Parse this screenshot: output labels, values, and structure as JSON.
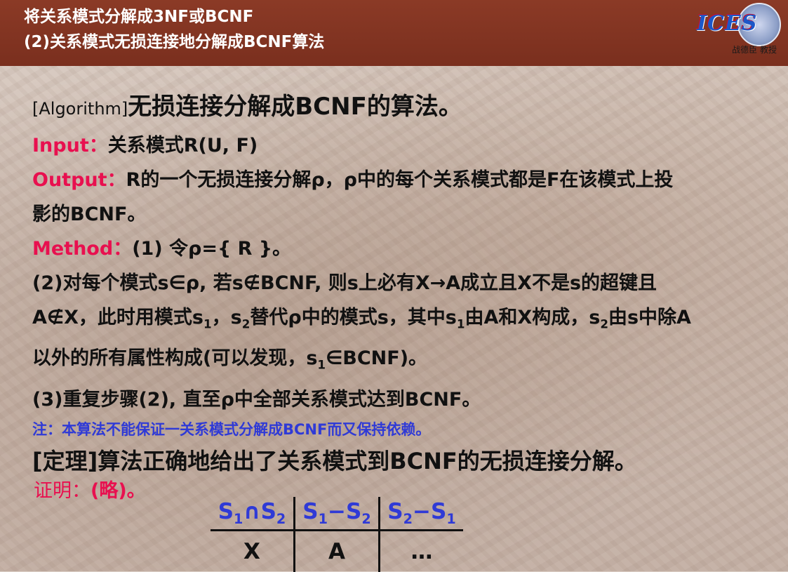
{
  "header": {
    "line1": "将关系模式分解成3NF或BCNF",
    "line2": "(2)关系模式无损连接地分解成BCNF算法"
  },
  "logo": {
    "brand": "ICES",
    "author": "战德臣 教授"
  },
  "algorithm": {
    "title_bracket": "[Algorithm]",
    "title_main": "无损连接分解成BCNF的算法。",
    "input_label": "Input：",
    "input_text": "关系模式R(U, F)",
    "output_label": "Output：",
    "output_text_1": "R的一个无损连接分解ρ，ρ中的每个关系模式都是F在该模式上投",
    "output_text_2": "影的BCNF。",
    "method_label": "Method：",
    "method_text": "(1) 令ρ={ R }。",
    "step2_line1": "(2)对每个模式s∈ρ, 若s∉BCNF, 则s上必有X→A成立且X不是s的超键且",
    "step2_l2_a": "A∉X，此时用模式s",
    "step2_l2_b": "1",
    "step2_l2_c": "，s",
    "step2_l2_d": "2",
    "step2_l2_e": "替代ρ中的模式s，其中s",
    "step2_l2_f": "1",
    "step2_l2_g": "由A和X构成，s",
    "step2_l2_h": "2",
    "step2_l2_i": "由s中除A",
    "step2_l3_a": "以外的所有属性构成(可以发现，s",
    "step2_l3_b": "1",
    "step2_l3_c": "∈BCNF)。",
    "step3": "(3)重复步骤(2), 直至ρ中全部关系模式达到BCNF。",
    "note": "注：本算法不能保证一关系模式分解成BCNF而又保持依赖。"
  },
  "theorem": "[定理]算法正确地给出了关系模式到BCNF的无损连接分解。",
  "proof": {
    "label": "证明：",
    "text": "(略)。"
  },
  "table": {
    "headers": [
      {
        "a": "S",
        "a_sub": "1",
        "op": "∩",
        "b": "S",
        "b_sub": "2"
      },
      {
        "a": "S",
        "a_sub": "1",
        "op": "−",
        "b": "S",
        "b_sub": "2"
      },
      {
        "a": "S",
        "a_sub": "2",
        "op": "−",
        "b": "S",
        "b_sub": "1"
      }
    ],
    "row": [
      "X",
      "A",
      "…"
    ]
  },
  "colors": {
    "header_bg": "#8b3a26",
    "accent_pink": "#e8104f",
    "accent_blue": "#2f3ad6"
  }
}
